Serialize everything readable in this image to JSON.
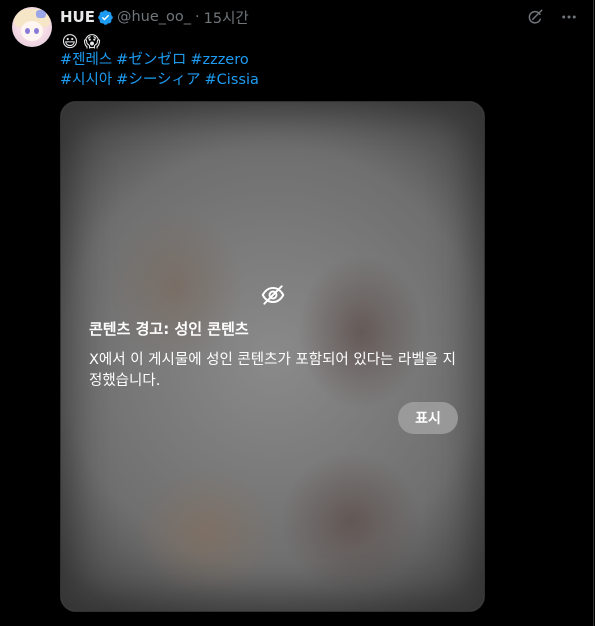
{
  "post": {
    "author": {
      "display_name": "HUE",
      "handle": "@hue_oo_",
      "verified": true
    },
    "separator": "·",
    "time": "15시간",
    "emojis": [
      "😃",
      "😱"
    ],
    "hashtags": [
      [
        "#젠레스",
        "#ゼンゼロ",
        "#zzzero"
      ],
      [
        "#시시아",
        "#シーシィア",
        "#Cissia"
      ]
    ],
    "media": {
      "warning_title": "콘텐츠 경고: 성인 콘텐츠",
      "warning_description": "X에서 이 게시물에 성인 콘텐츠가 포함되어 있다는 라벨을 지정했습니다.",
      "show_label": "표시"
    }
  },
  "icons": {
    "verified": "verified-badge-icon",
    "grok": "grok-icon",
    "more": "more-options-icon",
    "eye_off": "eye-off-icon"
  },
  "colors": {
    "background": "#000000",
    "text_primary": "#e7e9ea",
    "text_secondary": "#71767b",
    "link": "#1d9bf0",
    "verified": "#1d9bf0"
  }
}
